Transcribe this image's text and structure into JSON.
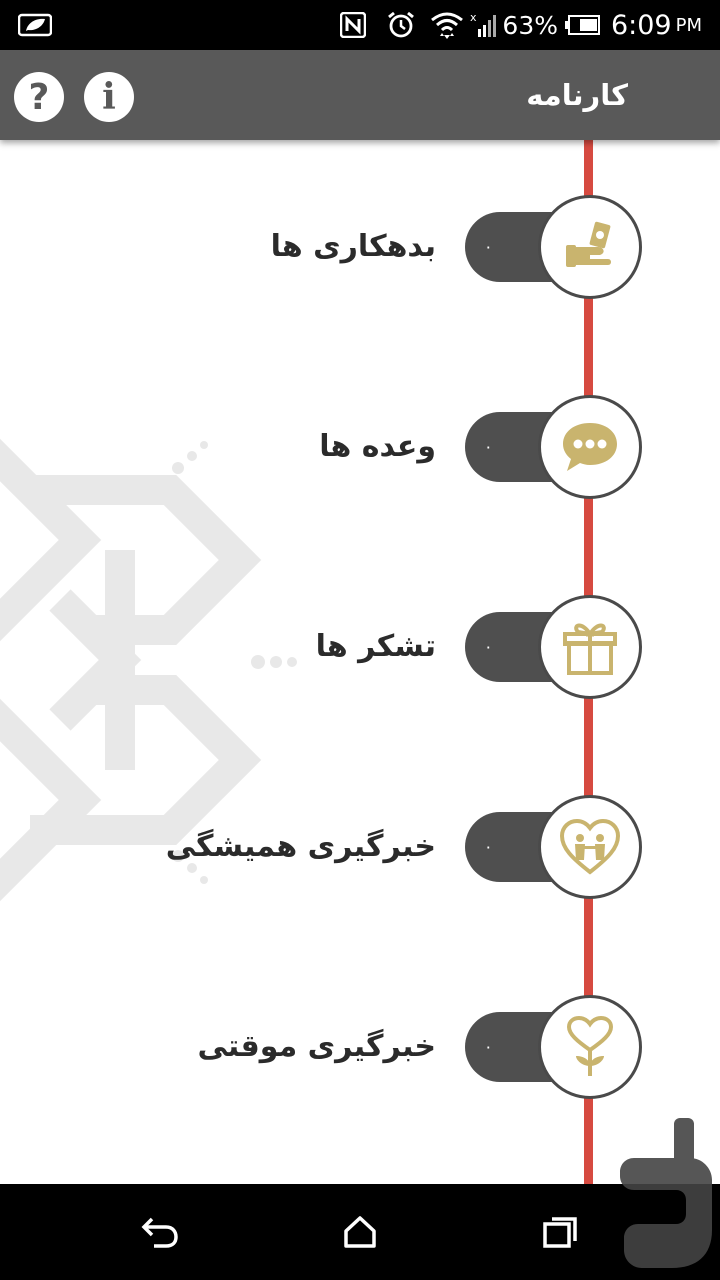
{
  "status_bar": {
    "battery_percent": "63%",
    "time": "6:09",
    "ampm": "PM",
    "icons": [
      "leaf-icon",
      "nfc-icon",
      "alarm-icon",
      "wifi-icon",
      "signal-icon",
      "battery-icon"
    ]
  },
  "app_bar": {
    "title": "کارنامه",
    "help_label": "?",
    "info_label": "i"
  },
  "timeline": {
    "items": [
      {
        "label": "بدهکاری ها",
        "count": "۰",
        "icon": "hand-money-icon"
      },
      {
        "label": "وعده ها",
        "count": "۰",
        "icon": "chat-bubble-icon"
      },
      {
        "label": "تشکر ها",
        "count": "۰",
        "icon": "gift-icon"
      },
      {
        "label": "خبرگیری همیشگی",
        "count": "۰",
        "icon": "heart-people-icon"
      },
      {
        "label": "خبرگیری موقتی",
        "count": "۰",
        "icon": "heart-flower-icon"
      }
    ]
  },
  "colors": {
    "app_bar": "#595959",
    "timeline_line": "#d64a40",
    "icon_gold": "#c9b46e",
    "pill": "#4f4f4f"
  }
}
